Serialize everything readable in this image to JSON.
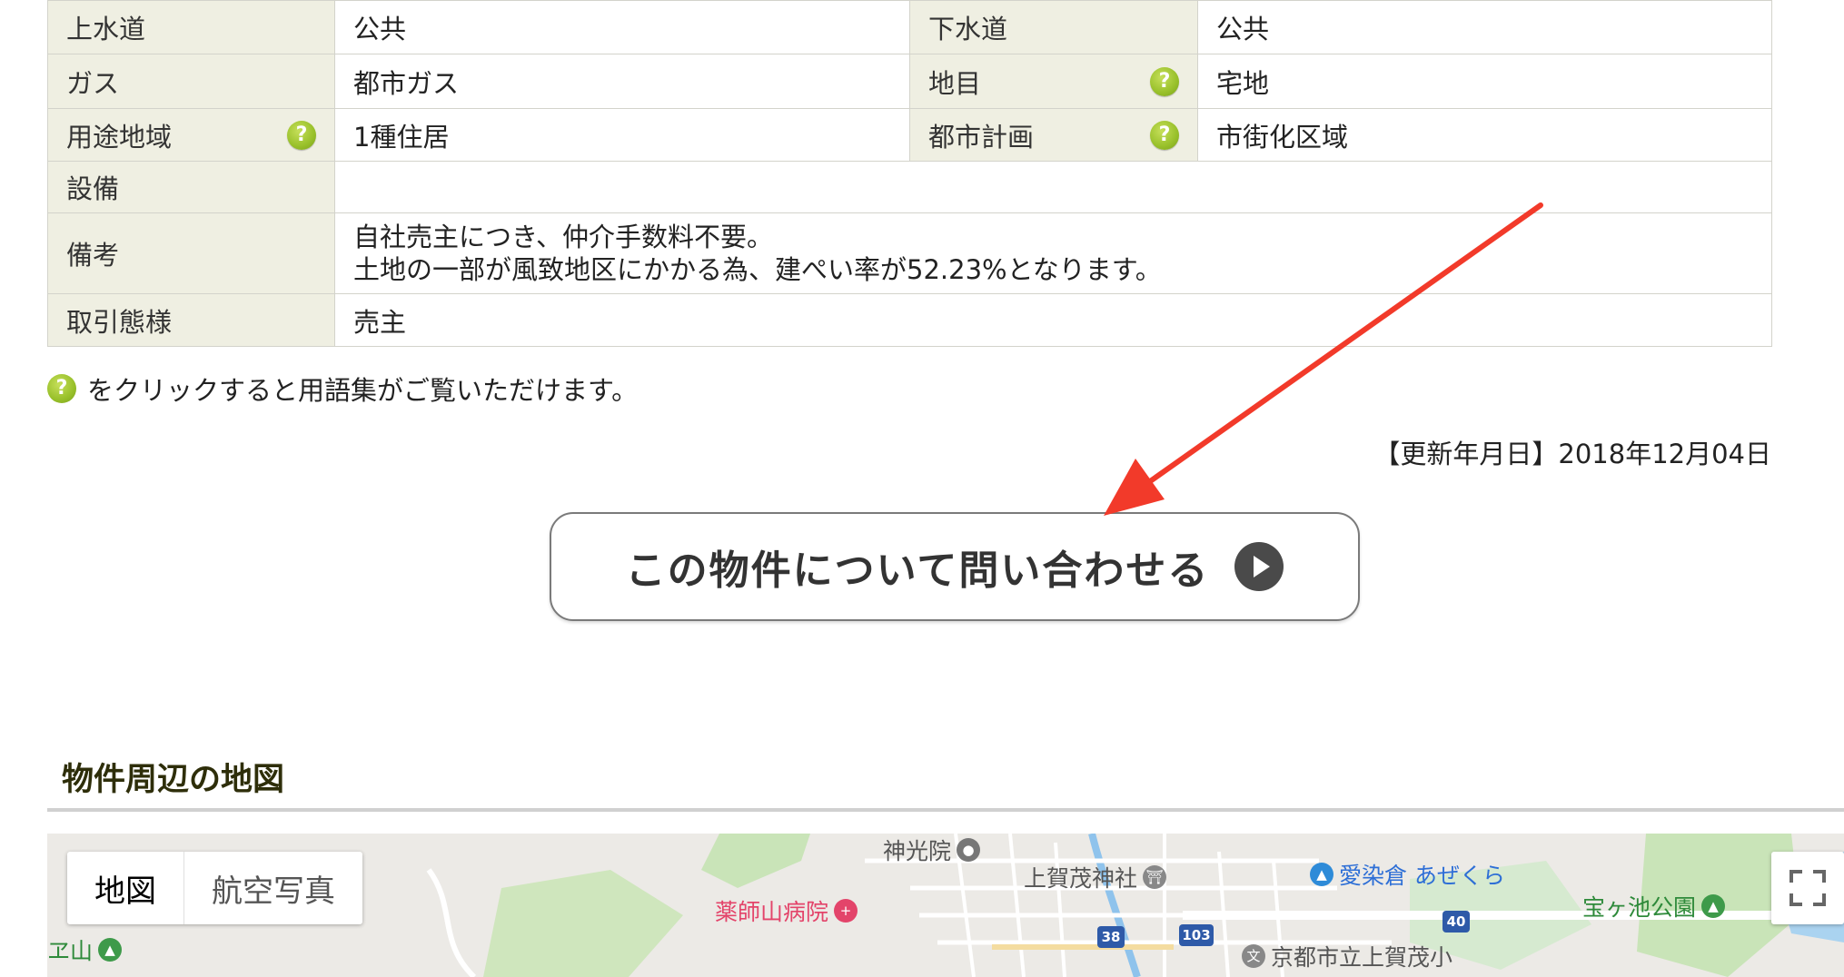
{
  "spec_rows": [
    {
      "label1": "上水道",
      "value1": "公共",
      "label2": "下水道",
      "value2": "公共"
    },
    {
      "label1": "ガス",
      "value1": "都市ガス",
      "label2": "地目",
      "value2": "宅地"
    },
    {
      "label1": "用途地域",
      "value1": "1種住居",
      "label2": "都市計画",
      "value2": "市街化区域"
    }
  ],
  "equipment": {
    "label": "設備",
    "value": ""
  },
  "remarks": {
    "label": "備考",
    "line1": "自社売主につき、仲介手数料不要。",
    "line2": "土地の一部が風致地区にかかる為、建ぺい率が52.23%となります。"
  },
  "transaction": {
    "label": "取引態様",
    "value": "売主"
  },
  "help_glyph": "?",
  "glossary_note": "をクリックすると用語集がご覧いただけます。",
  "updated": "【更新年月日】2018年12月04日",
  "inquiry_button": "この物件について問い合わせる",
  "map_section": {
    "title": "物件周辺の地図",
    "map_type": {
      "map": "地図",
      "satellite": "航空写真"
    },
    "pois": {
      "shinkoin": "神光院",
      "kamigamo_shrine": "上賀茂神社",
      "aizenkura": "愛染倉 あぜくら",
      "yakushiyama_hospital": "薬師山病院",
      "takaragaike_park": "宝ヶ池公園",
      "mountain": "ヱ山",
      "school": "京都市立上賀茂小"
    },
    "routes": {
      "r38": "38",
      "r103": "103",
      "r40": "40"
    }
  },
  "colors": {
    "header_bg": "#efefe2",
    "help_icon": "#98c02a",
    "arrow": "#f23a2a",
    "route_badge": "#2e5aa8"
  }
}
